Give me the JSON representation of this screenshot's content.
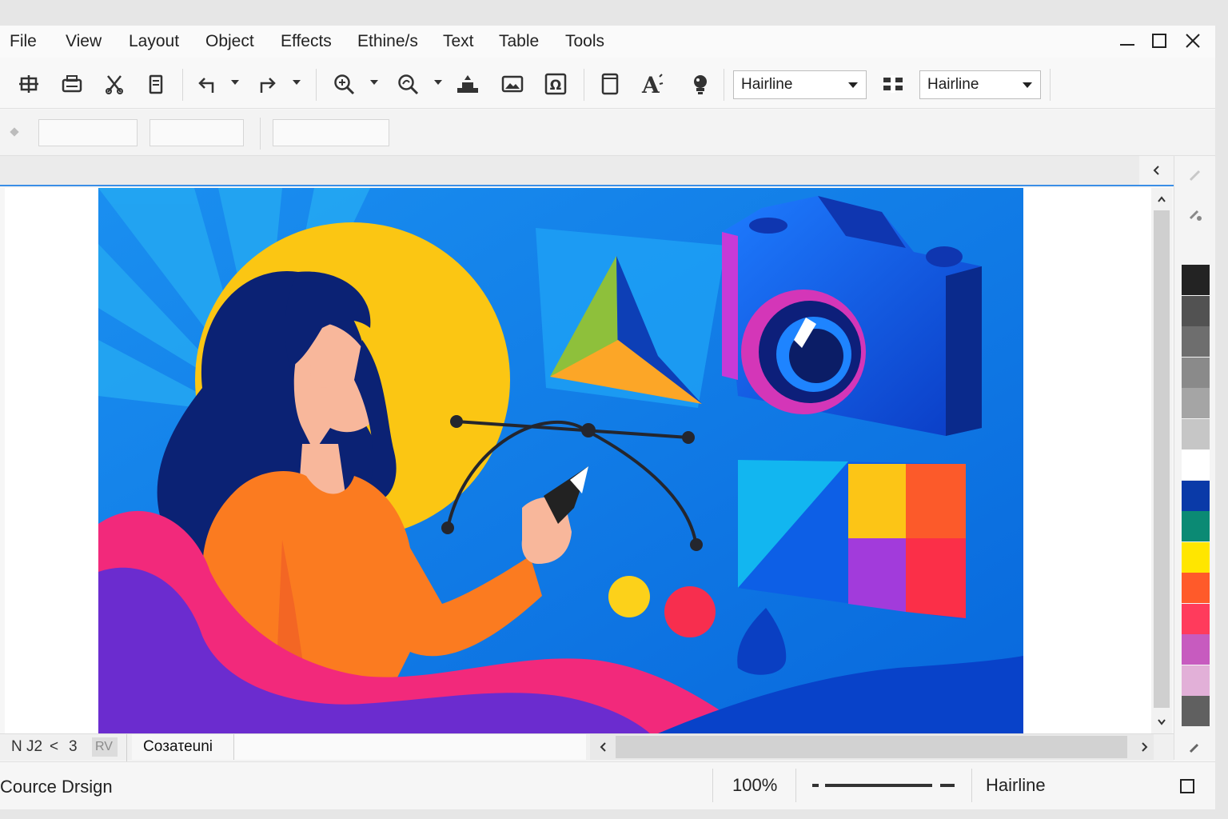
{
  "menu": {
    "items": [
      "File",
      "View",
      "Layout",
      "Object",
      "Effects",
      "Ethine/s",
      "Text",
      "Table",
      "Tools"
    ]
  },
  "window_controls": {
    "minimize": "minimize-icon",
    "maximize": "maximize-icon",
    "close": "close-icon"
  },
  "toolbar": {
    "outline_width_1": "Hairline",
    "outline_width_2": "Hairline"
  },
  "palette": [
    "#232323",
    "#525252",
    "#6e6e6e",
    "#8a8a8a",
    "#a5a5a5",
    "#c6c6c6",
    "#ffffff",
    "#0a3aa8",
    "#0b8a74",
    "#ffe600",
    "#ff5a2a",
    "#ff3b5c",
    "#c75bbf",
    "#e2b0d8",
    "#606060"
  ],
  "tabs_bar": {
    "page_nav": "N J2",
    "nav_prev": "<",
    "nav_next": "3",
    "page_box": "RV",
    "page_tab": "Coзaτeuni"
  },
  "status": {
    "document_name": "Cource Drsign",
    "zoom": "100%",
    "outline": "Hairline"
  },
  "colors": {
    "accent": "#3a8ee6",
    "canvas_blue": "#0a74e0"
  }
}
